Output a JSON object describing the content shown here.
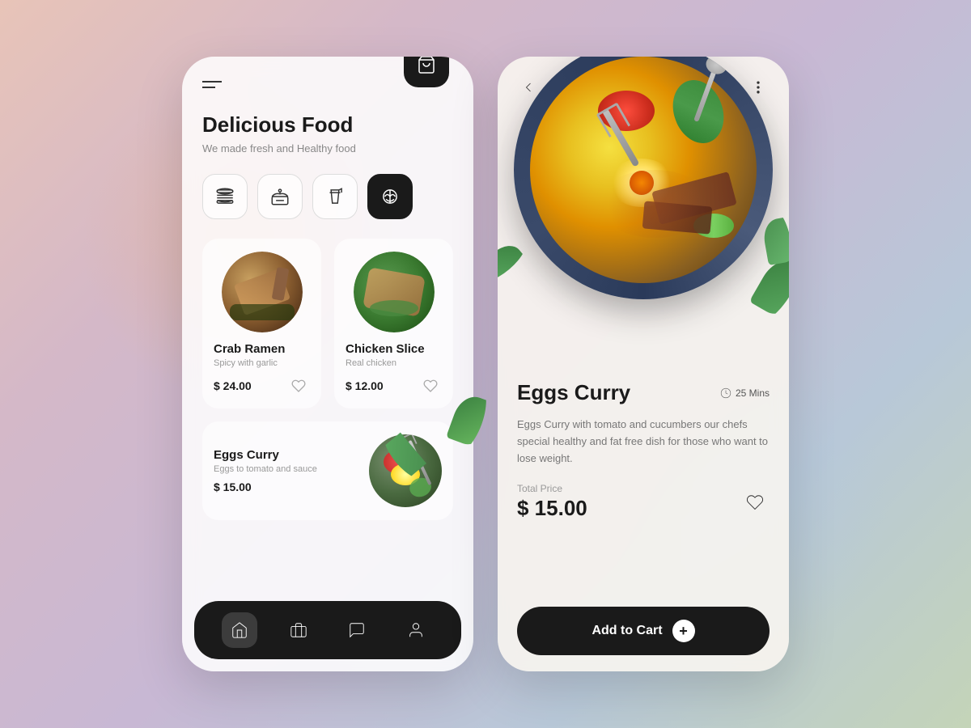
{
  "app": {
    "title": "Delicious Food",
    "subtitle": "We made fresh and Healthy food"
  },
  "left_phone": {
    "menu_label": "Menu",
    "cart_icon": "cart-icon",
    "categories": [
      {
        "id": "burger",
        "label": "Burger",
        "active": false
      },
      {
        "id": "cake",
        "label": "Cake",
        "active": false
      },
      {
        "id": "drinks",
        "label": "Drinks",
        "active": false
      },
      {
        "id": "food",
        "label": "Food",
        "active": true
      }
    ],
    "food_items": [
      {
        "id": "crab-ramen",
        "name": "Crab Ramen",
        "desc": "Spicy with garlic",
        "price": "$ 24.00"
      },
      {
        "id": "chicken-slice",
        "name": "Chicken Slice",
        "desc": "Real chicken",
        "price": "$ 12.00"
      }
    ],
    "featured_item": {
      "name": "Eggs Curry",
      "desc": "Eggs to tomato and sauce",
      "price": "$ 15.00"
    },
    "nav": [
      "home",
      "wallet",
      "chat",
      "profile"
    ]
  },
  "right_phone": {
    "back_label": "Back",
    "more_label": "More options",
    "dish": {
      "name": "Eggs Curry",
      "cook_time": "25 Mins",
      "description": "Eggs Curry with tomato and cucumbers our chefs special healthy and fat free dish for those who want to lose weight.",
      "total_label": "Total Price",
      "price": "$ 15.00"
    },
    "add_to_cart_label": "Add to Cart"
  },
  "colors": {
    "dark": "#1a1a1a",
    "accent": "#1a1a1a",
    "text_primary": "#1a1a1a",
    "text_secondary": "#888888",
    "card_bg": "rgba(255,255,255,0.6)",
    "phone_bg": "rgba(255,255,255,0.85)"
  }
}
